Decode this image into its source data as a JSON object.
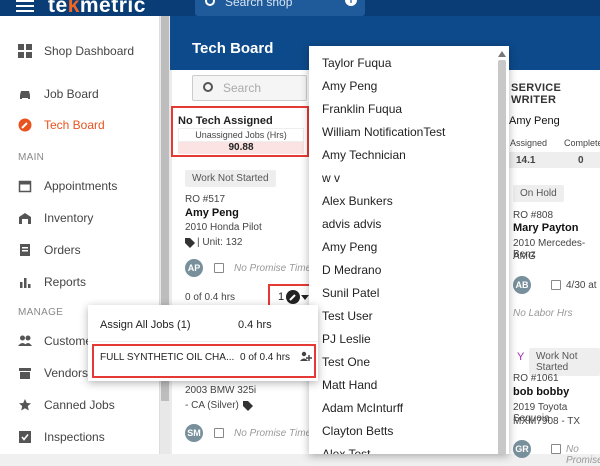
{
  "app": {
    "logo_prefix": "te",
    "logo_o": "k",
    "logo_suffix": "metric",
    "search_placeholder": "Search shop"
  },
  "sidebar": {
    "items": [
      {
        "label": "Shop Dashboard",
        "icon": "dashboard-icon"
      },
      {
        "label": "Job Board",
        "icon": "car-icon"
      },
      {
        "label": "Tech Board",
        "icon": "wrench-icon",
        "active": true
      }
    ],
    "section_main": "MAIN",
    "main_items": [
      {
        "label": "Appointments",
        "icon": "calendar-icon"
      },
      {
        "label": "Inventory",
        "icon": "inventory-icon"
      },
      {
        "label": "Orders",
        "icon": "orders-icon"
      },
      {
        "label": "Reports",
        "icon": "reports-icon"
      }
    ],
    "section_manage": "MANAGE",
    "manage_items": [
      {
        "label": "Custome",
        "icon": "people-icon"
      },
      {
        "label": "Vendors",
        "icon": "store-icon"
      },
      {
        "label": "Canned Jobs",
        "icon": "star-icon"
      },
      {
        "label": "Inspections",
        "icon": "check-icon"
      }
    ]
  },
  "main": {
    "title": "Tech Board",
    "search_placeholder": "Search",
    "no_tech": {
      "heading": "No Tech Assigned",
      "subheading": "Unassigned Jobs (Hrs)",
      "value": "90.88"
    },
    "card1": {
      "status": "Work Not Started",
      "ro": "RO #517",
      "customer": "Amy Peng",
      "vehicle": "2010 Honda Pilot",
      "unit": "| Unit: 132",
      "avatar": "AP",
      "promise": "No Promise Time",
      "hours": "0 of 0.4 hrs",
      "count": "1"
    },
    "card2": {
      "vehicle": "2003 BMW 325i",
      "detail": "- CA (Silver)",
      "avatar": "SM",
      "promise": "No Promise Time"
    },
    "assign_popup": {
      "assign_all_label": "Assign All Jobs (1)",
      "assign_all_hrs": "0.4 hrs",
      "job_label": "FULL SYNTHETIC OIL CHA...",
      "job_hrs": "0 of 0.4 hrs"
    },
    "tech_list": [
      "Taylor Fuqua",
      "Amy Peng",
      "Franklin Fuqua",
      "William NotificationTest",
      "Amy Technician",
      "w v",
      "Alex Bunkers",
      "advis advis",
      "Amy Peng",
      "D Medrano",
      "Sunil Patel",
      "Test User",
      "PJ Leslie",
      "Test One",
      "Matt Hand",
      "Adam McInturff",
      "Clayton Betts",
      "Alex Test"
    ],
    "service_writer": {
      "title": "SERVICE WRITER",
      "name": "Amy Peng",
      "col_assigned": "Assigned",
      "col_complete": "Complete",
      "assigned_val": "14.1",
      "complete_val": "0",
      "card1": {
        "status": "On Hold",
        "ro": "RO #808",
        "customer": "Mary Payton",
        "vehicle": "2010 Mercedes-Benz",
        "vehicle2": "AMG",
        "avatar": "AB",
        "date": "4/30 at",
        "labor": "No Labor Hrs"
      },
      "card2": {
        "status": "Work Not Started",
        "ro": "RO #1061",
        "customer": "bob bobby",
        "vehicle": "2019 Toyota Sequoia",
        "vehicle2": "MXM7908 - TX",
        "avatar": "GR",
        "promise": "No Promise"
      }
    }
  }
}
